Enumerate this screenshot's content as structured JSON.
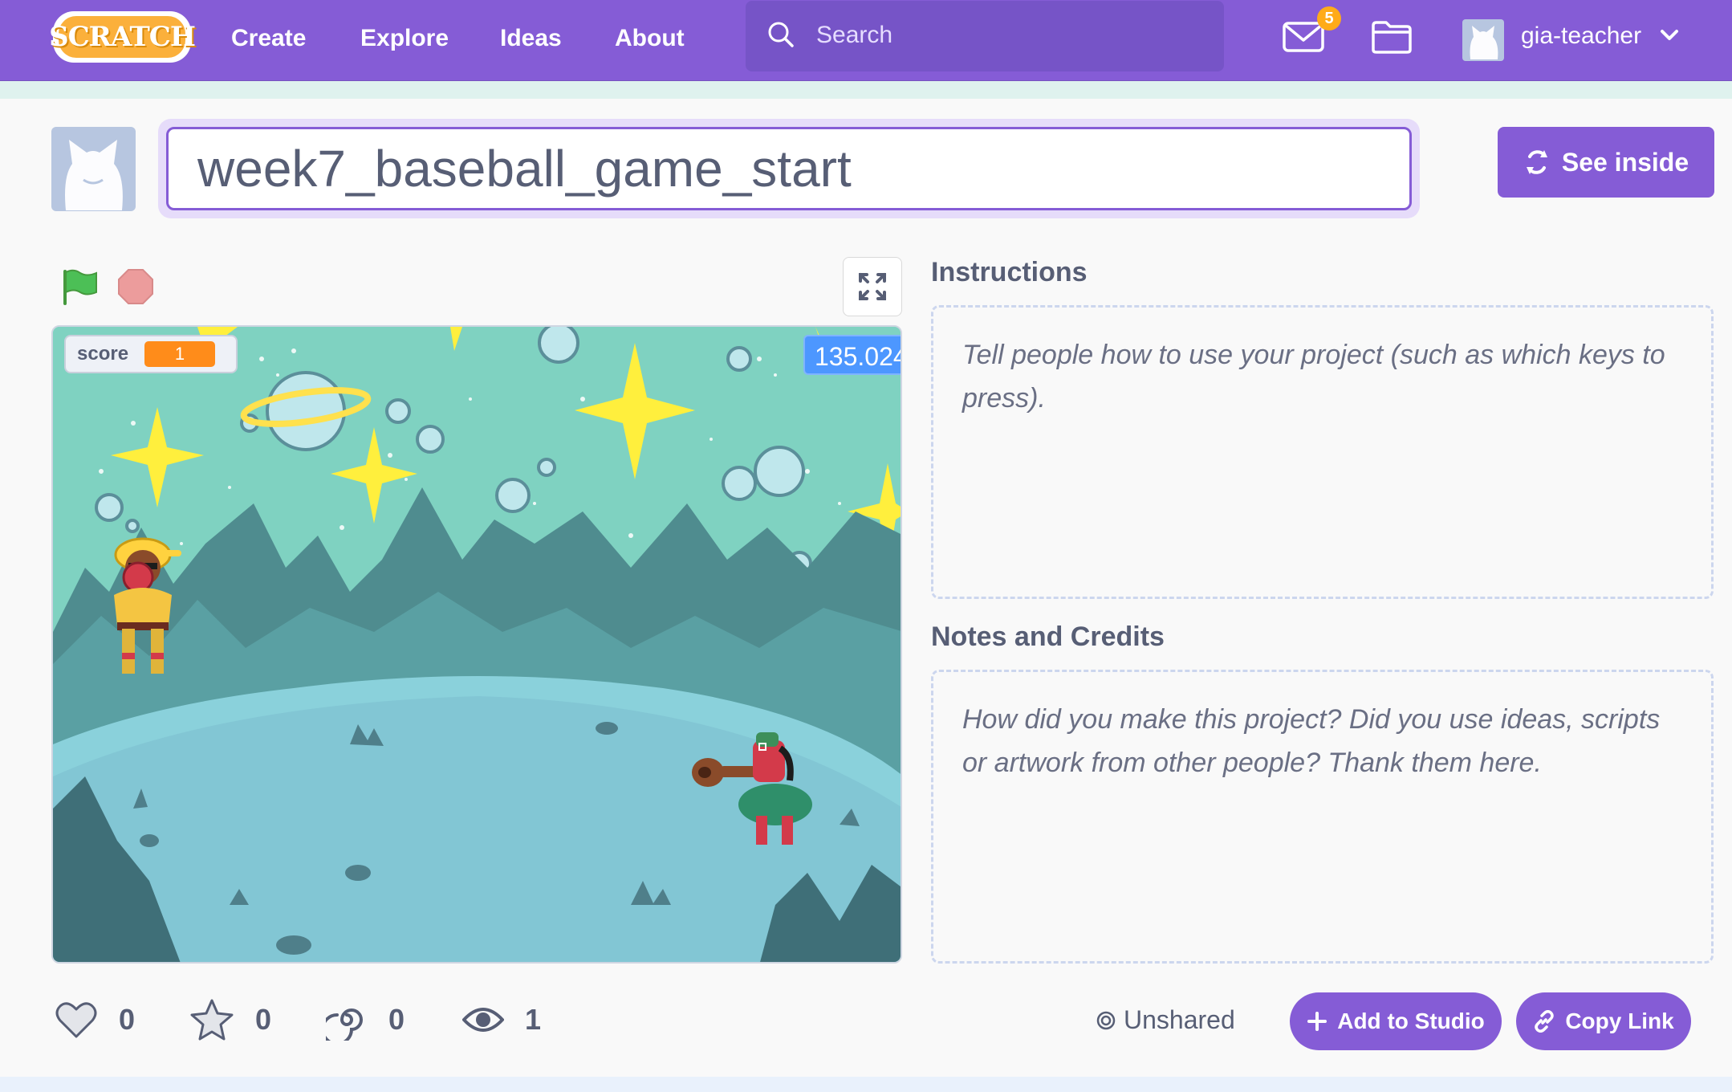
{
  "navbar": {
    "logo_text": "SCRATCH",
    "links": [
      "Create",
      "Explore",
      "Ideas",
      "About"
    ],
    "search_placeholder": "Search",
    "message_count": "5",
    "username": "gia-teacher",
    "icons": [
      "search-icon",
      "mail-icon",
      "folder-icon",
      "chevron-down-icon"
    ]
  },
  "project": {
    "title": "week7_baseball_game_start",
    "see_inside_label": "See inside"
  },
  "stage": {
    "monitors": {
      "score_label": "score",
      "score_value": "1",
      "timer_value": "135.024"
    }
  },
  "instructions": {
    "heading": "Instructions",
    "placeholder": "Tell people how to use your project (such as which keys to press)."
  },
  "notes": {
    "heading": "Notes and Credits",
    "placeholder": "How did you make this project? Did you use ideas, scripts or artwork from other people? Thank them here."
  },
  "stats": {
    "loves": "0",
    "favorites": "0",
    "remixes": "0",
    "views": "1"
  },
  "sharing": {
    "status": "Unshared",
    "add_to_studio_label": "Add to Studio",
    "copy_link_label": "Copy Link"
  },
  "colors": {
    "brand_purple": "#855cd6",
    "search_bg": "#7654c7",
    "badge_orange": "#ffab19",
    "score_orange": "#ff8c1a",
    "timer_blue": "#4d97ff"
  }
}
